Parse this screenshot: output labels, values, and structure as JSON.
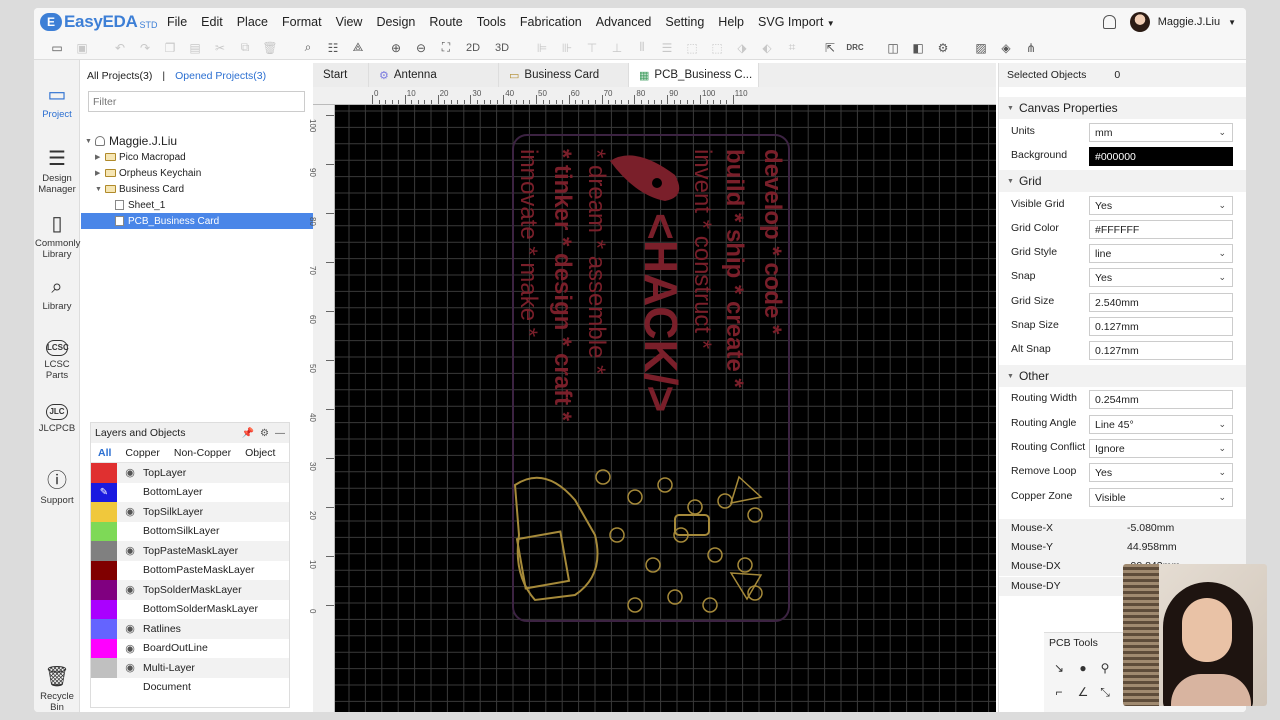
{
  "app": {
    "logo": "EasyEDA",
    "edition": "STD",
    "menu": [
      "File",
      "Edit",
      "Place",
      "Format",
      "View",
      "Design",
      "Route",
      "Tools",
      "Fabrication",
      "Advanced",
      "Setting",
      "Help",
      "SVG Import"
    ],
    "user": "Maggie.J.Liu"
  },
  "toolbar": {
    "label_2d": "2D",
    "label_3d": "3D",
    "label_drc": "DRC"
  },
  "leftrail": [
    {
      "label": "Project",
      "icon": "project-icon"
    },
    {
      "label": "Design Manager",
      "icon": "design-manager-icon"
    },
    {
      "label": "Commonly Library",
      "icon": "commonly-library-icon"
    },
    {
      "label": "Library",
      "icon": "library-search-icon"
    },
    {
      "label": "LCSC Parts",
      "icon": "lcsc-icon"
    },
    {
      "label": "JLCPCB",
      "icon": "jlcpcb-icon"
    },
    {
      "label": "Support",
      "icon": "support-icon"
    },
    {
      "label": "Recycle Bin",
      "icon": "recycle-bin-icon"
    }
  ],
  "project_panel": {
    "all_projects": "All Projects(3)",
    "separator": "|",
    "opened_projects": "Opened Projects(3)",
    "filter_placeholder": "Filter",
    "tree": [
      {
        "label": "Maggie.J.Liu"
      },
      {
        "label": "Pico Macropad"
      },
      {
        "label": "Orpheus Keychain"
      },
      {
        "label": "Business Card"
      },
      {
        "label": "Sheet_1"
      },
      {
        "label": "PCB_Business Card"
      }
    ]
  },
  "layers_panel": {
    "title": "Layers and Objects",
    "tabs": [
      "All",
      "Copper",
      "Non-Copper",
      "Object"
    ],
    "layers": [
      {
        "name": "TopLayer",
        "color": "#e03030"
      },
      {
        "name": "BottomLayer",
        "color": "#1a1ae0"
      },
      {
        "name": "TopSilkLayer",
        "color": "#f0c83c"
      },
      {
        "name": "BottomSilkLayer",
        "color": "#7ed957"
      },
      {
        "name": "TopPasteMaskLayer",
        "color": "#808080"
      },
      {
        "name": "BottomPasteMaskLayer",
        "color": "#800000"
      },
      {
        "name": "TopSolderMaskLayer",
        "color": "#800080"
      },
      {
        "name": "BottomSolderMaskLayer",
        "color": "#aa00ff"
      },
      {
        "name": "Ratlines",
        "color": "#6464ff"
      },
      {
        "name": "BoardOutLine",
        "color": "#ff00ff"
      },
      {
        "name": "Multi-Layer",
        "color": "#c0c0c0"
      },
      {
        "name": "Document",
        "color": "#ffffff"
      }
    ]
  },
  "doc_tabs": [
    {
      "label": "Start"
    },
    {
      "label": "Antenna"
    },
    {
      "label": "Business Card"
    },
    {
      "label": "PCB_Business C..."
    }
  ],
  "rulers": {
    "top": [
      "0",
      "10",
      "20",
      "30",
      "40",
      "50",
      "60",
      "70",
      "80",
      "90",
      "100",
      "110"
    ],
    "left": [
      "100",
      "90",
      "80",
      "70",
      "60",
      "50",
      "40",
      "30",
      "20",
      "10",
      "0"
    ]
  },
  "pcb_text": {
    "lines": [
      "develop * code *",
      "build * ship * create *",
      "invent * construct *",
      "<HACK/>",
      "* dream * assemble *",
      "* tinker * design * craft *",
      "innovate * make *"
    ]
  },
  "properties": {
    "selected_label": "Selected Objects",
    "selected_count": "0",
    "canvas_title": "Canvas Properties",
    "units_label": "Units",
    "units": "mm",
    "background_label": "Background",
    "background": "#000000",
    "grid_title": "Grid",
    "visible_grid_label": "Visible Grid",
    "visible_grid": "Yes",
    "grid_color_label": "Grid Color",
    "grid_color": "#FFFFFF",
    "grid_style_label": "Grid Style",
    "grid_style": "line",
    "snap_label": "Snap",
    "snap": "Yes",
    "grid_size_label": "Grid Size",
    "grid_size": "2.540mm",
    "snap_size_label": "Snap Size",
    "snap_size": "0.127mm",
    "alt_snap_label": "Alt Snap",
    "alt_snap": "0.127mm",
    "other_title": "Other",
    "routing_width_label": "Routing Width",
    "routing_width": "0.254mm",
    "routing_angle_label": "Routing Angle",
    "routing_angle": "Line 45°",
    "routing_conflict_label": "Routing Conflict",
    "routing_conflict": "Ignore",
    "remove_loop_label": "Remove Loop",
    "remove_loop": "Yes",
    "copper_zone_label": "Copper Zone",
    "copper_zone": "Visible"
  },
  "mouse": {
    "x_label": "Mouse-X",
    "x": "-5.080mm",
    "y_label": "Mouse-Y",
    "y": "44.958mm",
    "dx_label": "Mouse-DX",
    "dx": "-90.843mm",
    "dy_label": "Mouse-DY"
  },
  "pcb_tools": {
    "title": "PCB Tools"
  }
}
